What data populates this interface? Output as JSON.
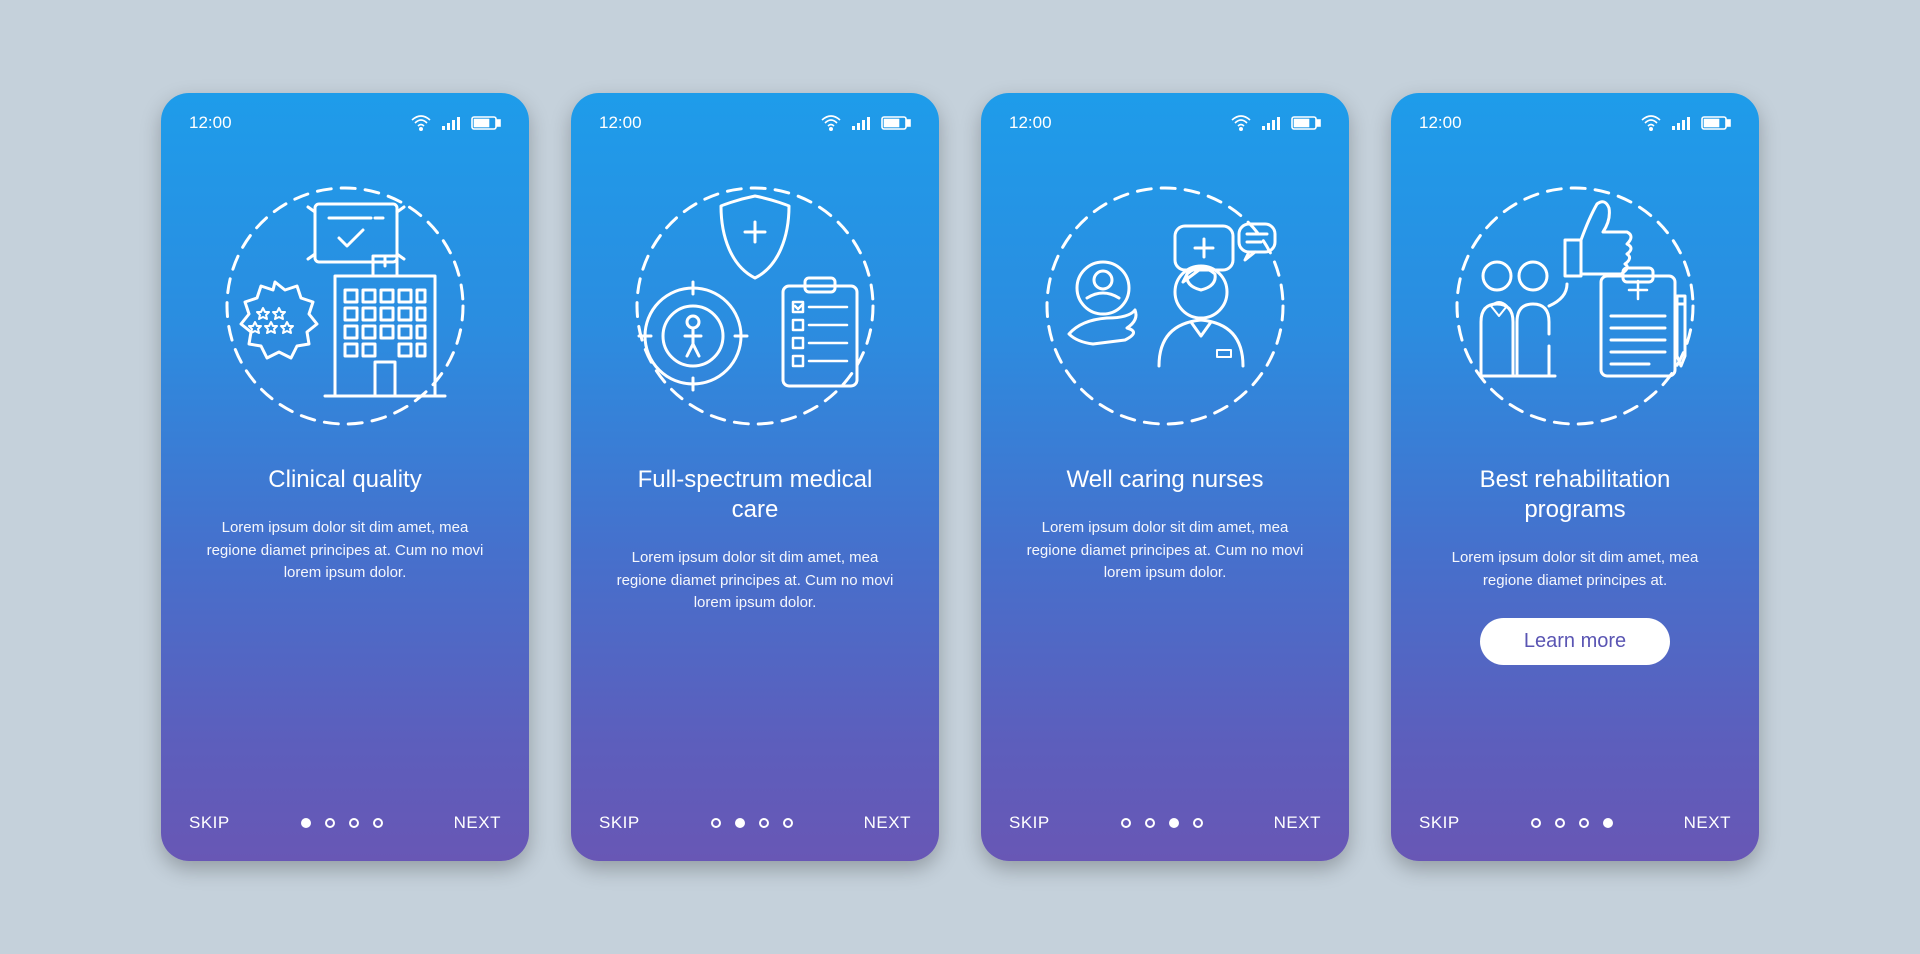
{
  "status_bar": {
    "time": "12:00"
  },
  "screens": [
    {
      "heading": "Clinical quality",
      "body": "Lorem ipsum dolor sit dim amet, mea regione diamet principes at. Cum no movi lorem ipsum dolor.",
      "skip": "SKIP",
      "next": "NEXT",
      "active_dot": 0,
      "cta": null
    },
    {
      "heading": "Full-spectrum medical care",
      "body": "Lorem ipsum dolor sit dim amet, mea regione diamet principes at. Cum no movi lorem ipsum dolor.",
      "skip": "SKIP",
      "next": "NEXT",
      "active_dot": 1,
      "cta": null
    },
    {
      "heading": "Well caring nurses",
      "body": "Lorem ipsum dolor sit dim amet, mea regione diamet principes at. Cum no movi lorem ipsum dolor.",
      "skip": "SKIP",
      "next": "NEXT",
      "active_dot": 2,
      "cta": null
    },
    {
      "heading": "Best rehabilitation programs",
      "body": "Lorem ipsum dolor sit dim amet, mea regione diamet principes at.",
      "skip": "SKIP",
      "next": "NEXT",
      "active_dot": 3,
      "cta": "Learn more"
    }
  ]
}
